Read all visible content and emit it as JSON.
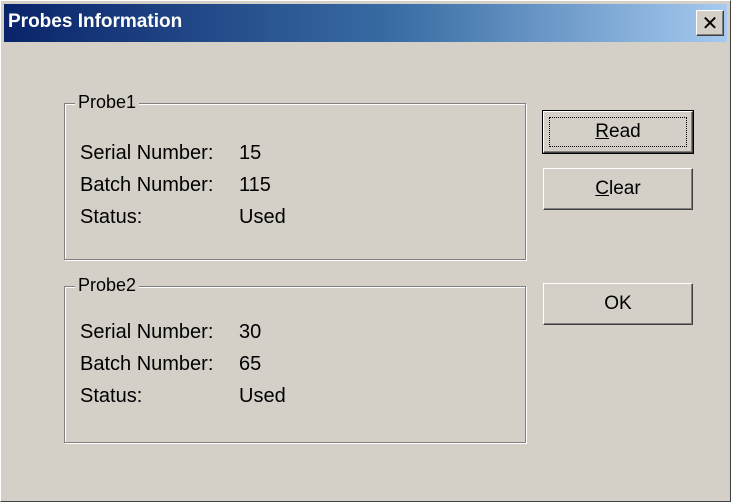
{
  "window": {
    "title": "Probes Information",
    "close_glyph": "✕"
  },
  "probe1": {
    "group_label": "Probe1",
    "serial_label": "Serial Number:",
    "serial_value": "15",
    "batch_label": "Batch Number:",
    "batch_value": "115",
    "status_label": "Status:",
    "status_value": "Used"
  },
  "probe2": {
    "group_label": "Probe2",
    "serial_label": "Serial Number:",
    "serial_value": "30",
    "batch_label": "Batch Number:",
    "batch_value": "65",
    "status_label": "Status:",
    "status_value": "Used"
  },
  "buttons": {
    "read": {
      "mnemonic": "R",
      "rest": "ead"
    },
    "clear": {
      "mnemonic": "C",
      "rest": "lear"
    },
    "ok": {
      "label": "OK"
    }
  },
  "colors": {
    "dialog_face": "#d4d0c8",
    "title_gradient_start": "#0a246a",
    "title_gradient_end": "#a6caf0",
    "title_text": "#ffffff"
  }
}
